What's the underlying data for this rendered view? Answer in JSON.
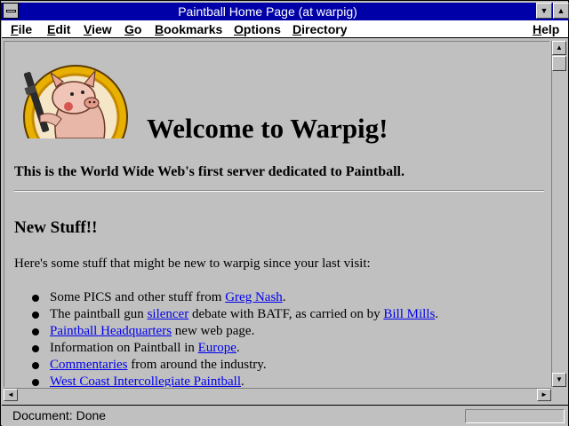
{
  "window": {
    "title": "Paintball Home Page (at warpig)"
  },
  "menu": {
    "items": [
      {
        "label": "File",
        "key": "F",
        "rest": "ile"
      },
      {
        "label": "Edit",
        "key": "E",
        "rest": "dit"
      },
      {
        "label": "View",
        "key": "V",
        "rest": "iew"
      },
      {
        "label": "Go",
        "key": "G",
        "rest": "o"
      },
      {
        "label": "Bookmarks",
        "key": "B",
        "rest": "ookmarks"
      },
      {
        "label": "Options",
        "key": "O",
        "rest": "ptions"
      },
      {
        "label": "Directory",
        "key": "D",
        "rest": "irectory"
      },
      {
        "label": "Help",
        "key": "H",
        "rest": "elp"
      }
    ]
  },
  "page": {
    "heading": "Welcome to Warpig!",
    "tagline": "This is the World Wide Web's first server dedicated to Paintball.",
    "section_title": "New Stuff!!",
    "intro": "Here's some stuff that might be new to warpig since your last visit:",
    "items": [
      {
        "before": "Some PICS and other stuff from ",
        "link": "Greg Nash",
        "after": "."
      },
      {
        "before": "The paintball gun ",
        "link": "silencer",
        "middle": " debate with BATF, as carried on by ",
        "link2": "Bill Mills",
        "after": "."
      },
      {
        "before": "",
        "link": "Paintball Headquarters",
        "after": " new web page."
      },
      {
        "before": "Information on Paintball in ",
        "link": "Europe",
        "after": "."
      },
      {
        "before": "",
        "link": "Commentaries",
        "after": " from around the industry."
      },
      {
        "before": "",
        "link": "West Coast Intercollegiate Paintball",
        "after": "."
      }
    ]
  },
  "status": {
    "text": "Document: Done"
  },
  "colors": {
    "titlebar": "#0000a8",
    "link": "#0000ee",
    "background": "#c0c0c0"
  },
  "icons": {
    "system_menu": "system-menu-icon",
    "minimize": "minimize-icon",
    "maximize": "maximize-icon"
  }
}
